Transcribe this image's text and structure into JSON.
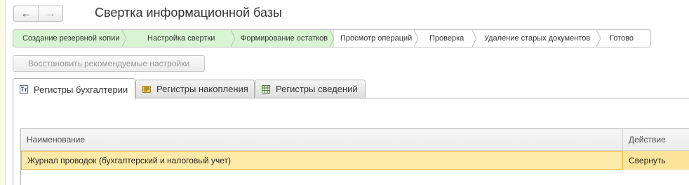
{
  "window": {
    "title": "Свертка информационной базы"
  },
  "nav": {
    "back_icon": "arrow-left-icon",
    "forward_icon": "arrow-right-icon"
  },
  "steps": [
    {
      "label": "Создание резервной копии",
      "done": true
    },
    {
      "label": "Настройка свертки",
      "done": true
    },
    {
      "label": "Формирование остатков",
      "done": true
    },
    {
      "label": "Просмотр операций",
      "done": false
    },
    {
      "label": "Проверка",
      "done": false
    },
    {
      "label": "Удаление старых документов",
      "done": false
    },
    {
      "label": "Готово",
      "done": false
    }
  ],
  "toolbar": {
    "restore_label": "Восстановить рекомендуемые настройки"
  },
  "tabs": [
    {
      "label": "Регистры бухгалтерии",
      "icon": "accounting-register-icon",
      "active": true
    },
    {
      "label": "Регистры накопления",
      "icon": "accumulation-register-icon",
      "active": false
    },
    {
      "label": "Регистры сведений",
      "icon": "information-register-icon",
      "active": false
    }
  ],
  "table": {
    "columns": [
      "Наименование",
      "Действие"
    ],
    "rows": [
      {
        "name": "Журнал проводок (бухгалтерский и налоговый учет)",
        "action": "Свернуть"
      }
    ]
  },
  "colors": {
    "step_done": "#d8f5d2",
    "row_selected": "#fbe39a",
    "row_border": "#e5b63c"
  }
}
